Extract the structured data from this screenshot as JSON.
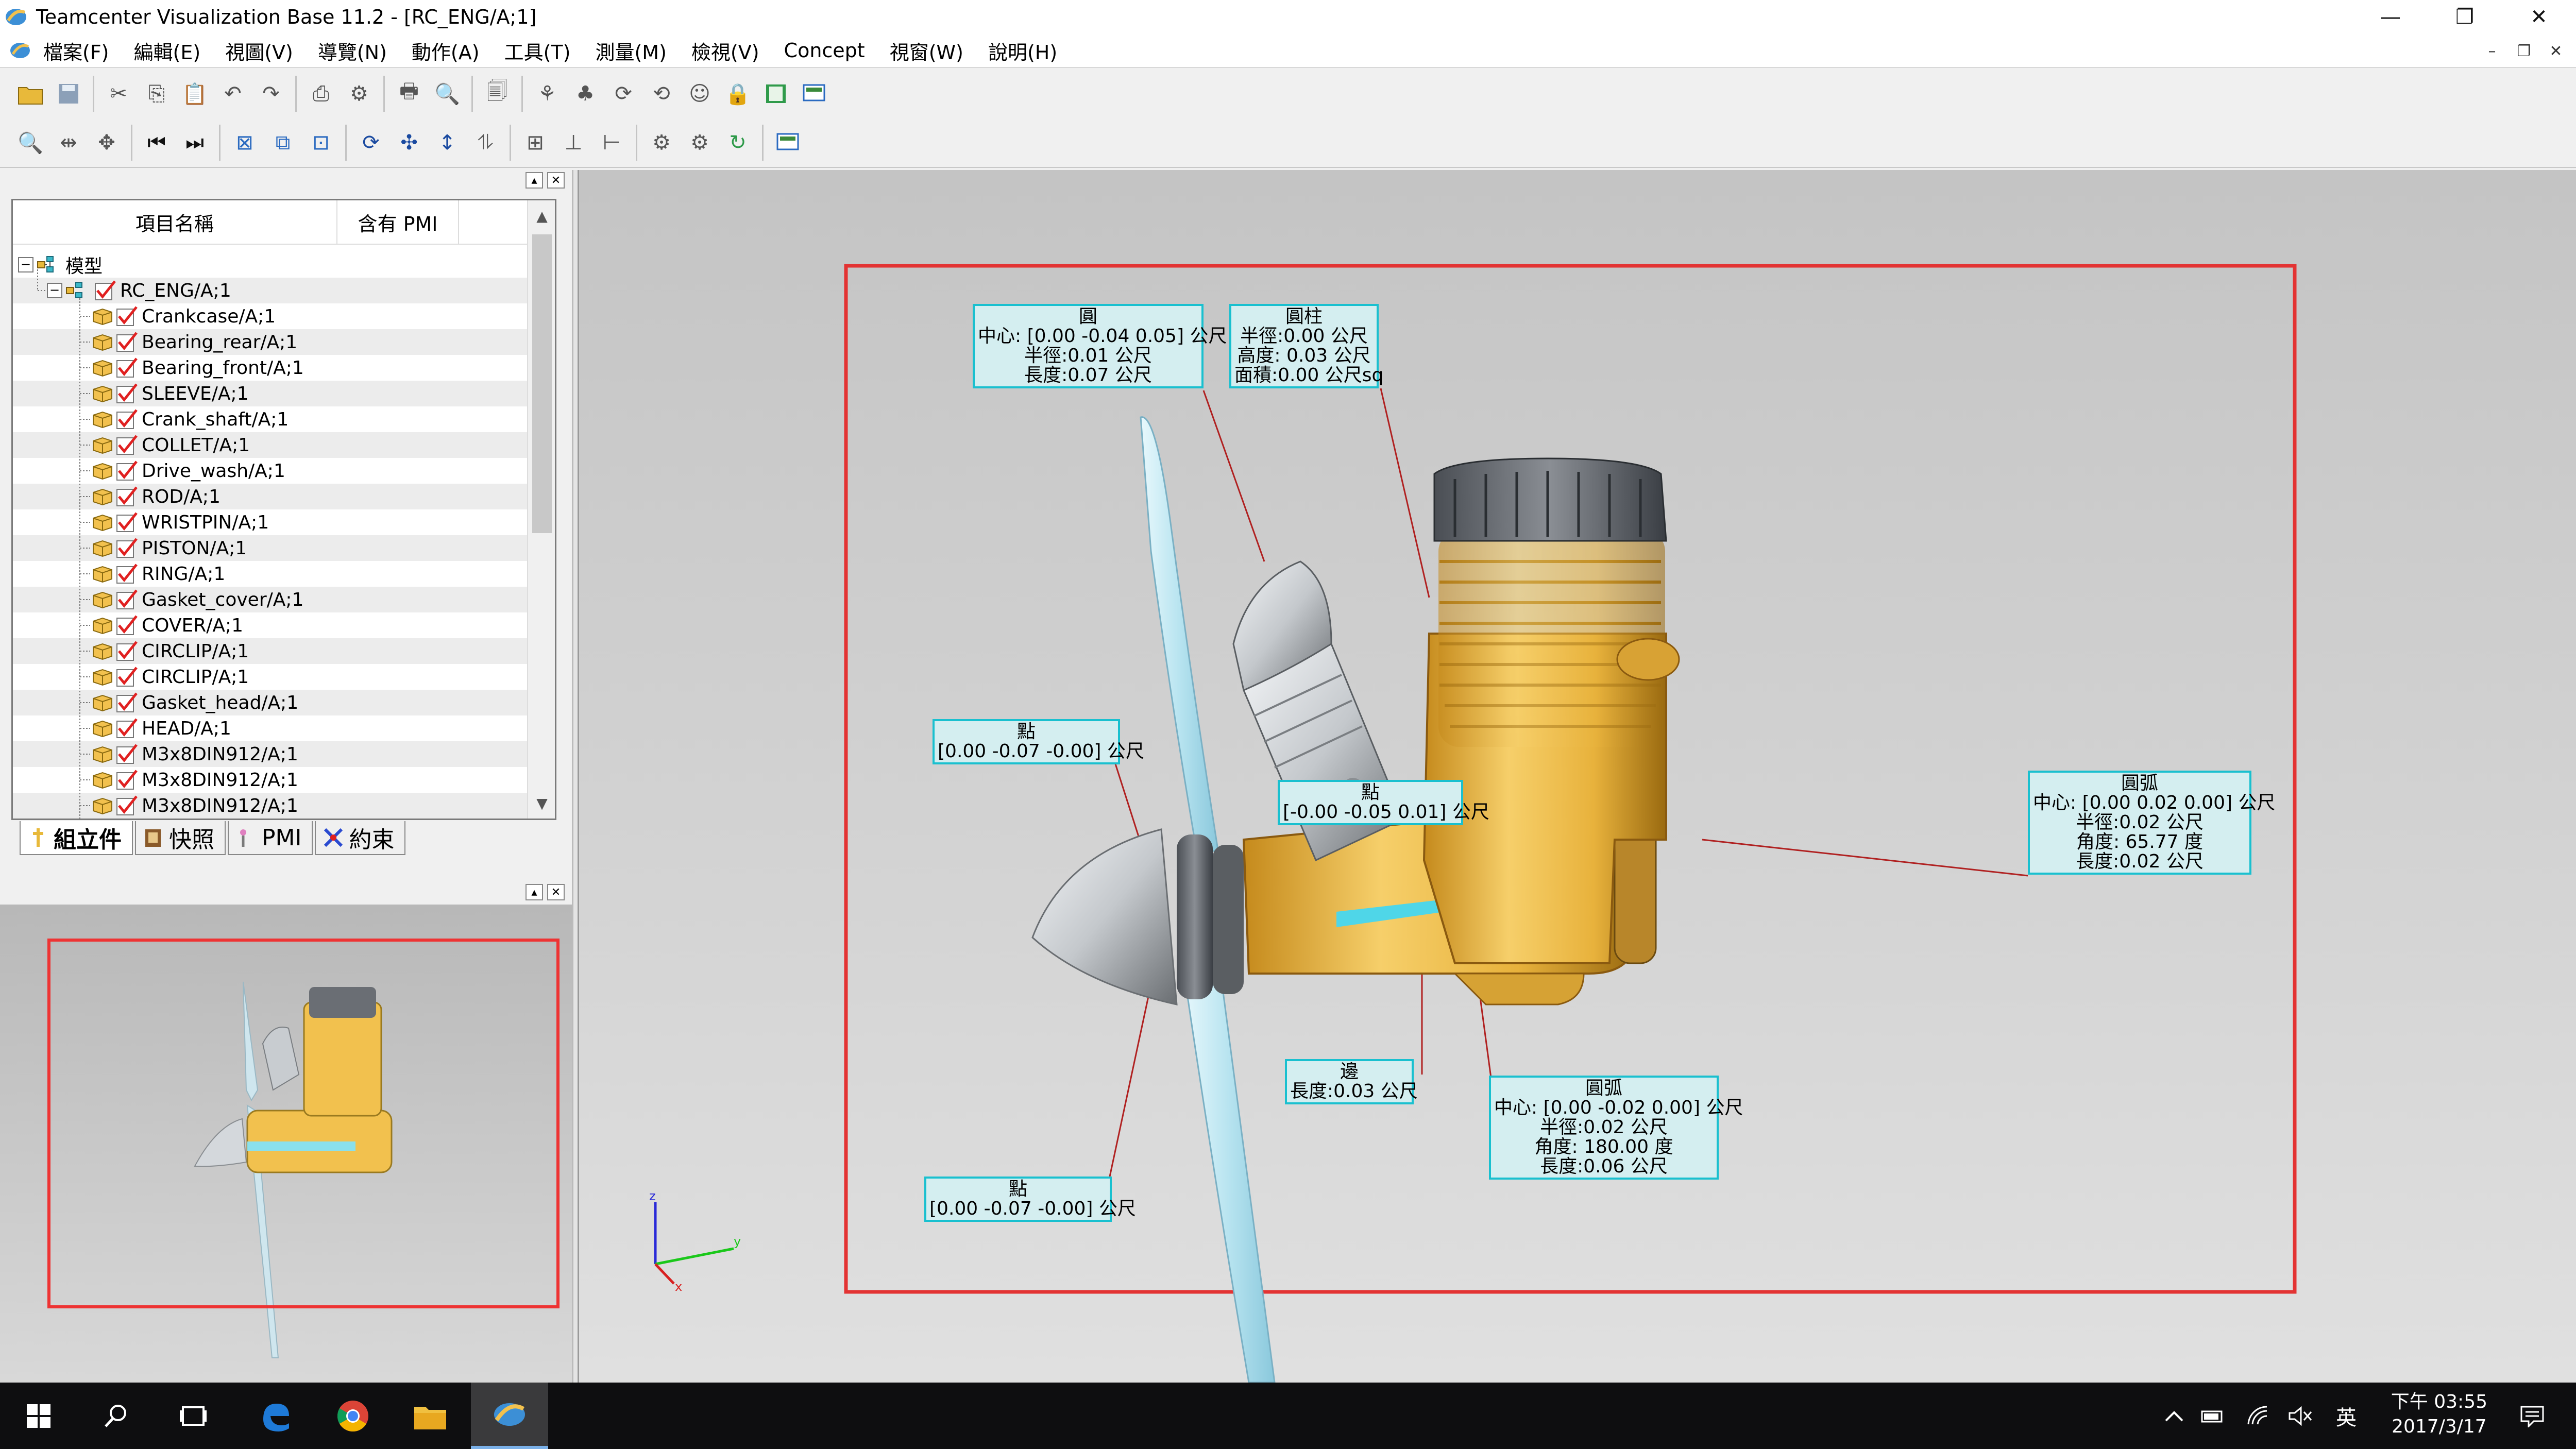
{
  "window": {
    "title": "Teamcenter Visualization Base 11.2 - [RC_ENG/A;1]",
    "minimize": "—",
    "restore": "❐",
    "close": "✕"
  },
  "menubar": {
    "items": [
      "檔案(F)",
      "編輯(E)",
      "視圖(V)",
      "導覽(N)",
      "動作(A)",
      "工具(T)",
      "測量(M)",
      "檢視(V)",
      "Concept",
      "視窗(W)",
      "說明(H)"
    ],
    "mdi_minimize": "–",
    "mdi_restore": "❐",
    "mdi_close": "✕"
  },
  "toolbar1": {
    "icons": [
      "open-folder-icon",
      "save-icon",
      "cut-icon",
      "copy-icon",
      "paste-icon",
      "undo-icon",
      "redo-icon",
      "print-icon",
      "settings-icon",
      "print-preview-icon",
      "page-setup-icon",
      "document-icon",
      "tree-icon",
      "hierarchy-icon",
      "sync-icon",
      "sync-all-icon",
      "person-icon",
      "lock-icon",
      "book-icon",
      "screen-icon"
    ]
  },
  "toolbar2": {
    "icons": [
      "zoom-icon",
      "pan-icon",
      "pick-icon",
      "first-frame-icon",
      "last-frame-icon",
      "fit-all-icon",
      "zoom-window-icon",
      "view-icon",
      "rotate-icon",
      "move-icon",
      "vertical-move-icon",
      "section-icon",
      "align-icon",
      "tree-branch-icon",
      "measure-icon",
      "group-a-icon",
      "group-b-icon",
      "refresh-icon",
      "display-icon"
    ]
  },
  "tree": {
    "col_name": "項目名稱",
    "col_pmi": "含有 PMI",
    "root": "模型",
    "assembly": "RC_ENG/A;1",
    "parts": [
      "Crankcase/A;1",
      "Bearing_rear/A;1",
      "Bearing_front/A;1",
      "SLEEVE/A;1",
      "Crank_shaft/A;1",
      "COLLET/A;1",
      "Drive_wash/A;1",
      "ROD/A;1",
      "WRISTPIN/A;1",
      "PISTON/A;1",
      "RING/A;1",
      "Gasket_cover/A;1",
      "COVER/A;1",
      "CIRCLIP/A;1",
      "CIRCLIP/A;1",
      "Gasket_head/A;1",
      "HEAD/A;1",
      "M3x8DIN912/A;1",
      "M3x8DIN912/A;1",
      "M3x8DIN912/A;1"
    ],
    "expand_minus": "−",
    "scroll_up": "▲",
    "scroll_down": "▼"
  },
  "tabs": {
    "assembly": "組立件",
    "snapshot": "快照",
    "pmi": "PMI",
    "constraint": "約束"
  },
  "pmi": {
    "circle": {
      "title": "圓",
      "lines": [
        "中心: [0.00 -0.04 0.05] 公尺",
        "半徑:0.01 公尺",
        "長度:0.07 公尺"
      ]
    },
    "cylinder": {
      "title": "圓柱",
      "lines": [
        "半徑:0.00 公尺",
        "高度: 0.03 公尺",
        "面積:0.00 公尺sq"
      ]
    },
    "point1": {
      "title": "點",
      "lines": [
        "[0.00 -0.07 -0.00] 公尺"
      ]
    },
    "point2": {
      "title": "點",
      "lines": [
        "[-0.00 -0.05 0.01] 公尺"
      ]
    },
    "arc1": {
      "title": "圓弧",
      "lines": [
        "中心: [0.00 0.02 0.00] 公尺",
        "半徑:0.02 公尺",
        "角度: 65.77 度",
        "長度:0.02 公尺"
      ]
    },
    "edge": {
      "title": "邊",
      "lines": [
        "長度:0.03 公尺"
      ]
    },
    "arc2": {
      "title": "圓弧",
      "lines": [
        "中心: [0.00 -0.02 0.00] 公尺",
        "半徑:0.02 公尺",
        "角度: 180.00 度",
        "長度:0.06 公尺"
      ]
    },
    "point3": {
      "title": "點",
      "lines": [
        "[0.00 -0.07 -0.00] 公尺"
      ]
    }
  },
  "axes": {
    "z": "z",
    "y": "y",
    "x": "x"
  },
  "taskbar": {
    "ime": "英",
    "time": "下午 03:55",
    "date": "2017/3/17"
  },
  "colors": {
    "selection_frame": "#e33333",
    "pmi_border": "#19c0cf",
    "pmi_fill": "#d4eef0",
    "engine_gold": "#f2c14e"
  }
}
